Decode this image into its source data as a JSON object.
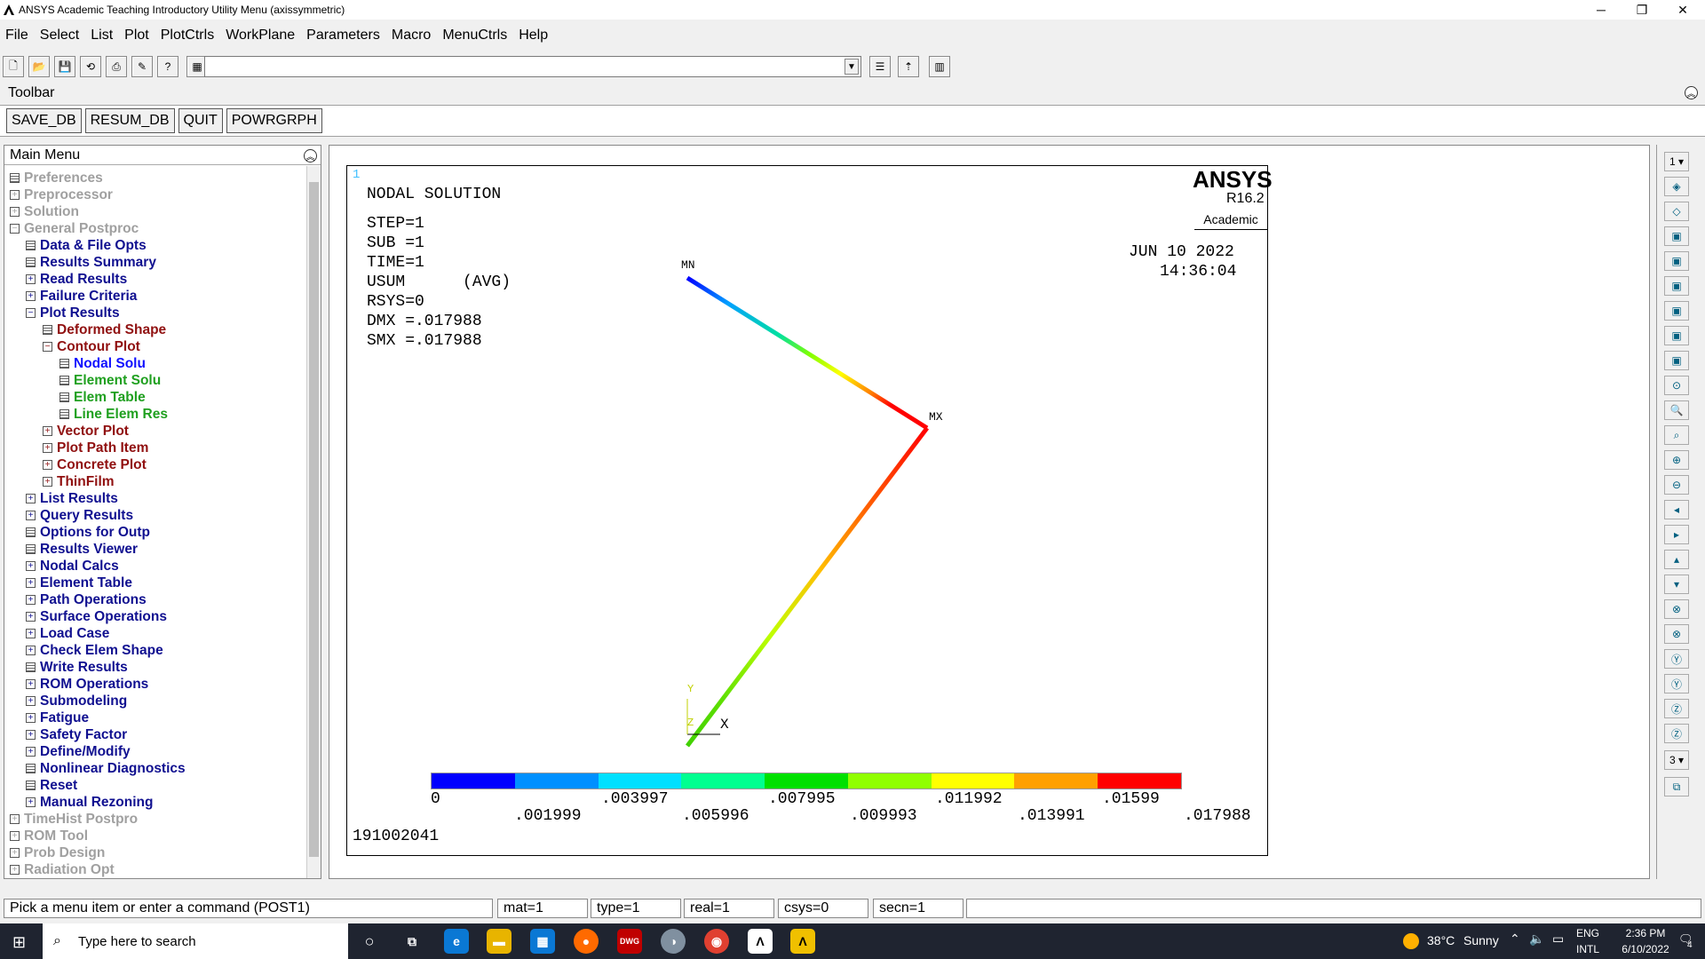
{
  "window": {
    "title": "ANSYS Academic Teaching Introductory Utility Menu (axissymmetric)"
  },
  "menu": [
    "File",
    "Select",
    "List",
    "Plot",
    "PlotCtrls",
    "WorkPlane",
    "Parameters",
    "Macro",
    "MenuCtrls",
    "Help"
  ],
  "toolbar": {
    "title": "Toolbar",
    "buttons": [
      "SAVE_DB",
      "RESUM_DB",
      "QUIT",
      "POWRGRPH"
    ]
  },
  "main_menu": {
    "title": "Main Menu",
    "items": [
      {
        "label": "Preferences"
      },
      {
        "label": "Preprocessor"
      },
      {
        "label": "Solution"
      },
      {
        "label": "General Postproc"
      },
      {
        "label": "Data & File Opts"
      },
      {
        "label": "Results Summary"
      },
      {
        "label": "Read Results"
      },
      {
        "label": "Failure Criteria"
      },
      {
        "label": "Plot Results"
      },
      {
        "label": "Deformed Shape"
      },
      {
        "label": "Contour Plot"
      },
      {
        "label": "Nodal Solu"
      },
      {
        "label": "Element Solu"
      },
      {
        "label": "Elem Table"
      },
      {
        "label": "Line Elem Res"
      },
      {
        "label": "Vector Plot"
      },
      {
        "label": "Plot Path Item"
      },
      {
        "label": "Concrete Plot"
      },
      {
        "label": "ThinFilm"
      },
      {
        "label": "List Results"
      },
      {
        "label": "Query Results"
      },
      {
        "label": "Options for Outp"
      },
      {
        "label": "Results Viewer"
      },
      {
        "label": "Nodal Calcs"
      },
      {
        "label": "Element Table"
      },
      {
        "label": "Path Operations"
      },
      {
        "label": "Surface Operations"
      },
      {
        "label": "Load Case"
      },
      {
        "label": "Check Elem Shape"
      },
      {
        "label": "Write Results"
      },
      {
        "label": "ROM Operations"
      },
      {
        "label": "Submodeling"
      },
      {
        "label": "Fatigue"
      },
      {
        "label": "Safety Factor"
      },
      {
        "label": "Define/Modify"
      },
      {
        "label": "Nonlinear Diagnostics"
      },
      {
        "label": "Reset"
      },
      {
        "label": "Manual Rezoning"
      },
      {
        "label": "TimeHist Postpro"
      },
      {
        "label": "ROM Tool"
      },
      {
        "label": "Prob Design"
      },
      {
        "label": "Radiation Opt"
      }
    ]
  },
  "graphics": {
    "window_number": "1",
    "heading": "NODAL SOLUTION",
    "info": [
      "STEP=1",
      "SUB =1",
      "TIME=1",
      "USUM      (AVG)",
      "RSYS=0",
      "DMX =.017988",
      "SMX =.017988"
    ],
    "brand": "ANSYS",
    "release": "R16.2",
    "license": "Academic",
    "date": "JUN 10 2022",
    "time": "14:36:04",
    "min_label": "MN",
    "max_label": "MX",
    "axis_x": "X",
    "axis_y": "Y",
    "axis_z": "Z",
    "legend_top": [
      "0",
      ".003997",
      ".007995",
      ".011992",
      ".01599"
    ],
    "legend_bottom": [
      ".001999",
      ".005996",
      ".009993",
      ".013991",
      ".017988"
    ],
    "legend_colors": [
      "#0000ff",
      "#0090ff",
      "#00e0ff",
      "#00ff90",
      "#00e000",
      "#90ff00",
      "#ffff00",
      "#ffa000",
      "#ff0000"
    ],
    "id_text": "191002041"
  },
  "right_panel": {
    "window_select": "1",
    "view_select": "3"
  },
  "status_bar": {
    "prompt": "Pick a menu item or enter a command (POST1)",
    "mat": "mat=1",
    "type": "type=1",
    "real": "real=1",
    "csys": "csys=0",
    "secn": "secn=1"
  },
  "taskbar": {
    "search_placeholder": "Type here to search",
    "weather_temp": "38°C",
    "weather_desc": "Sunny",
    "lang1": "ENG",
    "lang2": "INTL",
    "time": "2:36 PM",
    "date": "6/10/2022",
    "notifications": "4"
  }
}
